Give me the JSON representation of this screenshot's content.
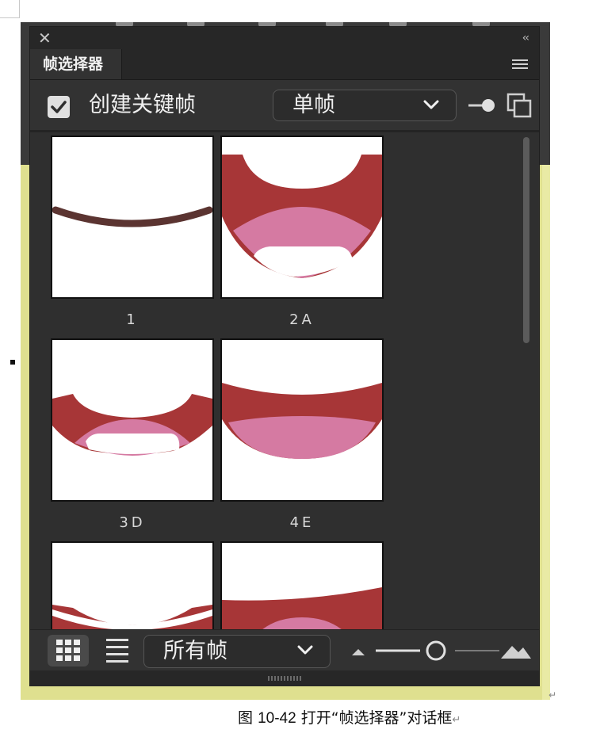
{
  "panel": {
    "tab_label": "帧选择器",
    "close_icon": "close-icon",
    "collapse_label": "‹‹",
    "create_keyframe_label": "创建关键帧",
    "create_keyframe_checked": true,
    "mode_dropdown_value": "单帧",
    "filter_dropdown_value": "所有帧"
  },
  "frames": [
    {
      "label": "1"
    },
    {
      "label": "2A"
    },
    {
      "label": "3D"
    },
    {
      "label": "4E"
    }
  ],
  "caption": {
    "prefix": "图",
    "number": "10-42",
    "text": "打开“帧选择器”对话框"
  },
  "colors": {
    "panel_bg": "#323232",
    "mouth_red": "#a73637",
    "mouth_pink": "#d57aa2",
    "lip_brown": "#5b3431",
    "host_bg": "#dfe08f"
  }
}
